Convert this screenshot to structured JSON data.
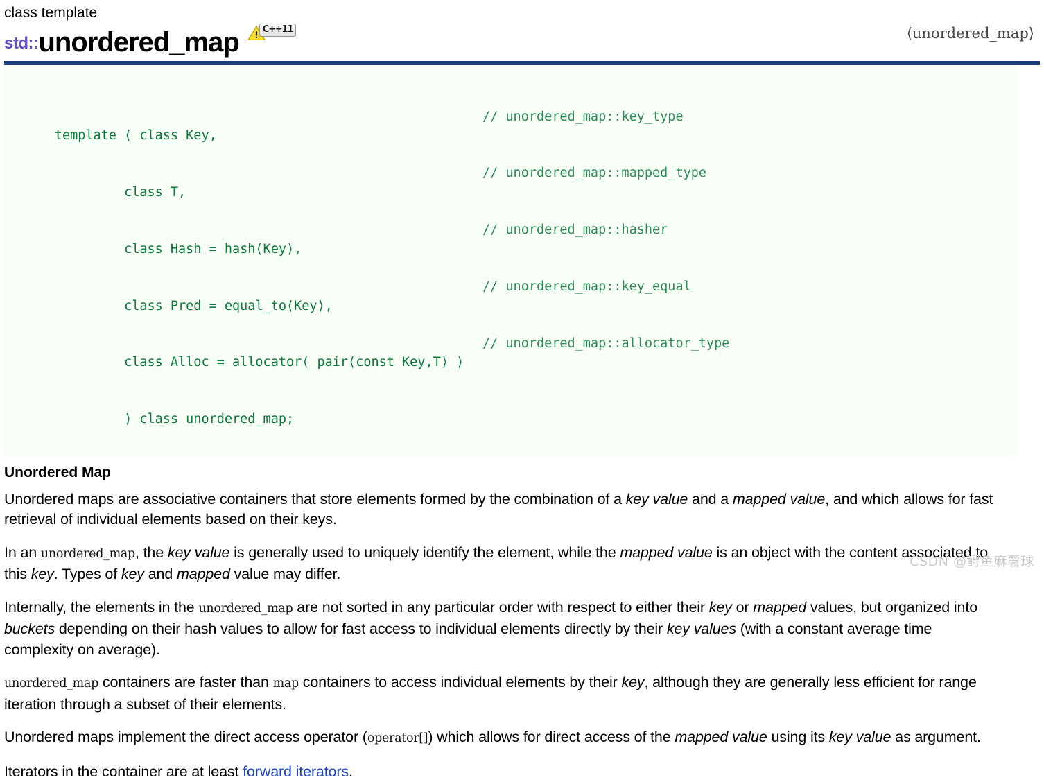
{
  "header": {
    "kicker": "class template",
    "namespace": "std::",
    "class_name": "unordered_map",
    "warning_icon": "warning-triangle-icon",
    "standard_badge": "C++11",
    "header_file": "⟨unordered_map⟩",
    "accent_rule_color": "#1c3f7c",
    "namespace_color": "#6154c4"
  },
  "code_block": {
    "background_color": "#f7fff7",
    "code_color": "#0b7a3b",
    "comment_color": "#2e8b57",
    "lines": [
      {
        "code": "template ⟨ class Key,",
        "comment": "// unordered_map::key_type"
      },
      {
        "code": "         class T,",
        "comment": "// unordered_map::mapped_type"
      },
      {
        "code": "         class Hash = hash⟨Key⟩,",
        "comment": "// unordered_map::hasher"
      },
      {
        "code": "         class Pred = equal_to⟨Key⟩,",
        "comment": "// unordered_map::key_equal"
      },
      {
        "code": "         class Alloc = allocator⟨ pair⟨const Key,T⟩ ⟩",
        "comment": "// unordered_map::allocator_type"
      },
      {
        "code": "         ⟩ class unordered_map;",
        "comment": ""
      }
    ]
  },
  "section": {
    "title": "Unordered Map"
  },
  "paragraphs": {
    "p1": {
      "s1": "Unordered maps are associative containers that store elements formed by the combination of a ",
      "em1": "key value",
      "s2": " and a ",
      "em2": "mapped value",
      "s3": ", and which allows for fast retrieval of individual elements based on their keys."
    },
    "p2": {
      "s1": "In an ",
      "code1": "unordered_map",
      "s2": ", the ",
      "em1": "key value",
      "s3": " is generally used to uniquely identify the element, while the ",
      "em2": "mapped value",
      "s4": " is an object with the content associated to this ",
      "em3": "key",
      "s5": ". Types of ",
      "em4": "key",
      "s6": " and ",
      "em5": "mapped",
      "s7": " value may differ."
    },
    "p3": {
      "s1": "Internally, the elements in the ",
      "code1": "unordered_map",
      "s2": " are not sorted in any particular order with respect to either their ",
      "em1": "key",
      "s3": " or ",
      "em2": "mapped",
      "s4": " values, but organized into ",
      "em3": "buckets",
      "s5": " depending on their hash values to allow for fast access to individual elements directly by their ",
      "em4": "key values",
      "s6": " (with a constant average time complexity on average)."
    },
    "p4": {
      "code1": "unordered_map",
      "s1": " containers are faster than ",
      "code2": "map",
      "s2": " containers to access individual elements by their ",
      "em1": "key",
      "s3": ", although they are generally less efficient for range iteration through a subset of their elements."
    },
    "p5": {
      "s1": "Unordered maps implement the direct access operator (",
      "code1": "operator[]",
      "s2": ") which allows for direct access of the ",
      "em1": "mapped value",
      "s3": " using its ",
      "em2": "key value",
      "s4": " as argument."
    },
    "p6": {
      "s1": "Iterators in the container are at least ",
      "link": "forward iterators",
      "s2": "."
    }
  },
  "watermark": {
    "text": "CSDN @鳄鱼麻薯球"
  }
}
